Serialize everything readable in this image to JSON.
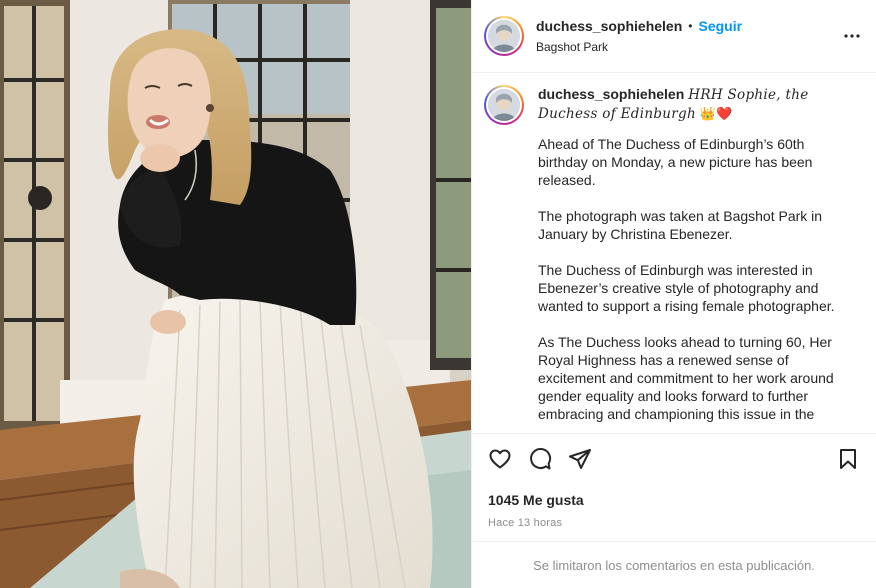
{
  "post": {
    "username": "duchess_sophiehelen",
    "separator": "•",
    "follow_label": "Seguir",
    "location": "Bagshot Park"
  },
  "caption": {
    "username": "duchess_sophiehelen",
    "display_name": "HRH Sophie, the Duchess of Edinburgh",
    "emojis": "👑❤️",
    "paragraphs": [
      "Ahead of The Duchess of Edinburgh’s 60th birthday on Monday, a new picture has been released.",
      "The photograph was taken at Bagshot Park in January by Christina Ebenezer.",
      "The Duchess of Edinburgh was interested in Ebenezer’s creative style of photography and wanted to support a rising female photographer.",
      "As The Duchess looks ahead to turning 60, Her Royal Highness has a renewed sense of excitement and commitment to her work around gender equality and looks forward to further embracing and championing this issue in the"
    ]
  },
  "actions": {
    "like_icon": "heart-icon",
    "comment_icon": "comment-icon",
    "share_icon": "share-icon",
    "save_icon": "bookmark-icon",
    "more_icon": "more-options-icon"
  },
  "stats": {
    "likes": "1045 Me gusta",
    "timestamp": "Hace 13 horas"
  },
  "comments": {
    "limited_note": "Se limitaron los comentarios en esta publicación."
  }
}
